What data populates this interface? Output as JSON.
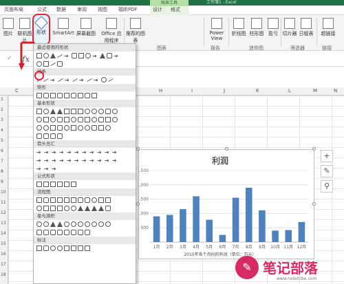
{
  "window": {
    "title": "工作簿1 - Excel",
    "tool_header": "图表工具"
  },
  "tabs": [
    "页面布局",
    "公式",
    "数据",
    "审阅",
    "视图",
    "福昕PDF",
    "设计",
    "格式"
  ],
  "ribbon": {
    "buttons": [
      "图片",
      "联机图片",
      "形状",
      "SmartArt",
      "屏幕截图",
      "Office 应用程序",
      "推荐的图表",
      "Power View",
      "折线图",
      "柱形图",
      "盈亏",
      "切片器",
      "日程表",
      "超链接"
    ],
    "groups": [
      "图表",
      "报告",
      "迷你图",
      "筛选器",
      "链接"
    ]
  },
  "formula": {
    "fx": "fx",
    "check": "✓"
  },
  "columns": [
    "C",
    "H",
    "I",
    "J",
    "K",
    "L",
    "M",
    "N"
  ],
  "rows": [
    "1",
    "2",
    "3",
    "4",
    "5",
    "6",
    "7",
    "8",
    "9",
    "10",
    "11",
    "12",
    "13",
    "14",
    "15",
    "16",
    "17",
    "18"
  ],
  "shapes_panel": {
    "sections": [
      "最近使用的形状",
      "线条",
      "矩形",
      "基本形状",
      "箭头总汇",
      "公式形状",
      "流程图",
      "星与旗帜",
      "标注"
    ]
  },
  "chart_data": {
    "type": "bar",
    "title": "利润",
    "xlabel": "2015年各个月份的利润（单位：万元）",
    "ylabel": "",
    "categories": [
      "1月",
      "2月",
      "3月",
      "4月",
      "5月",
      "6月",
      "7月",
      "8月",
      "9月",
      "10月",
      "11月",
      "12月"
    ],
    "values": [
      900,
      950,
      1150,
      1600,
      780,
      250,
      1550,
      1900,
      1110,
      400,
      420,
      700
    ],
    "ytick_labels": [
      "500",
      "1,000",
      "1,500",
      "2,000",
      "2,500"
    ],
    "ylim": [
      0,
      2500
    ],
    "bar_color": "#4f81bd",
    "grid": true
  },
  "side_tools": [
    "plus-icon",
    "brush-icon",
    "filter-icon"
  ],
  "watermark": {
    "text": "笔记部落",
    "url": "www.notetribe.com"
  }
}
